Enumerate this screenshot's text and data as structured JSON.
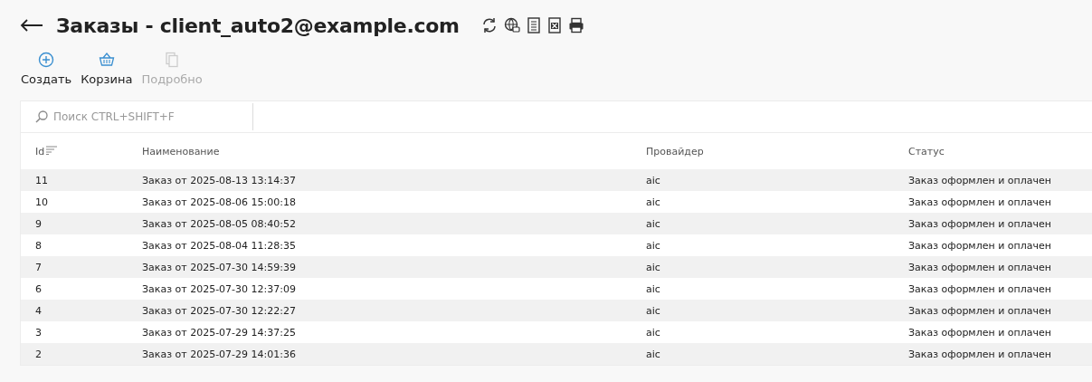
{
  "header": {
    "title": "Заказы - client_auto2@example.com"
  },
  "toolbar": [
    {
      "label": "Создать",
      "kind": "create",
      "disabled": false
    },
    {
      "label": "Корзина",
      "kind": "basket",
      "disabled": false
    },
    {
      "label": "Подробно",
      "kind": "details",
      "disabled": true
    }
  ],
  "search": {
    "placeholder": "Поиск CTRL+SHIFT+F"
  },
  "table": {
    "columns": [
      "Id",
      "Наименование",
      "Провайдер",
      "Статус"
    ],
    "rows": [
      [
        "11",
        "Заказ от 2025-08-13 13:14:37",
        "aic",
        "Заказ оформлен и оплачен"
      ],
      [
        "10",
        "Заказ от 2025-08-06 15:00:18",
        "aic",
        "Заказ оформлен и оплачен"
      ],
      [
        "9",
        "Заказ от 2025-08-05 08:40:52",
        "aic",
        "Заказ оформлен и оплачен"
      ],
      [
        "8",
        "Заказ от 2025-08-04 11:28:35",
        "aic",
        "Заказ оформлен и оплачен"
      ],
      [
        "7",
        "Заказ от 2025-07-30 14:59:39",
        "aic",
        "Заказ оформлен и оплачен"
      ],
      [
        "6",
        "Заказ от 2025-07-30 12:37:09",
        "aic",
        "Заказ оформлен и оплачен"
      ],
      [
        "4",
        "Заказ от 2025-07-30 12:22:27",
        "aic",
        "Заказ оформлен и оплачен"
      ],
      [
        "3",
        "Заказ от 2025-07-29 14:37:25",
        "aic",
        "Заказ оформлен и оплачен"
      ],
      [
        "2",
        "Заказ от 2025-07-29 14:01:36",
        "aic",
        "Заказ оформлен и оплачен"
      ]
    ]
  }
}
